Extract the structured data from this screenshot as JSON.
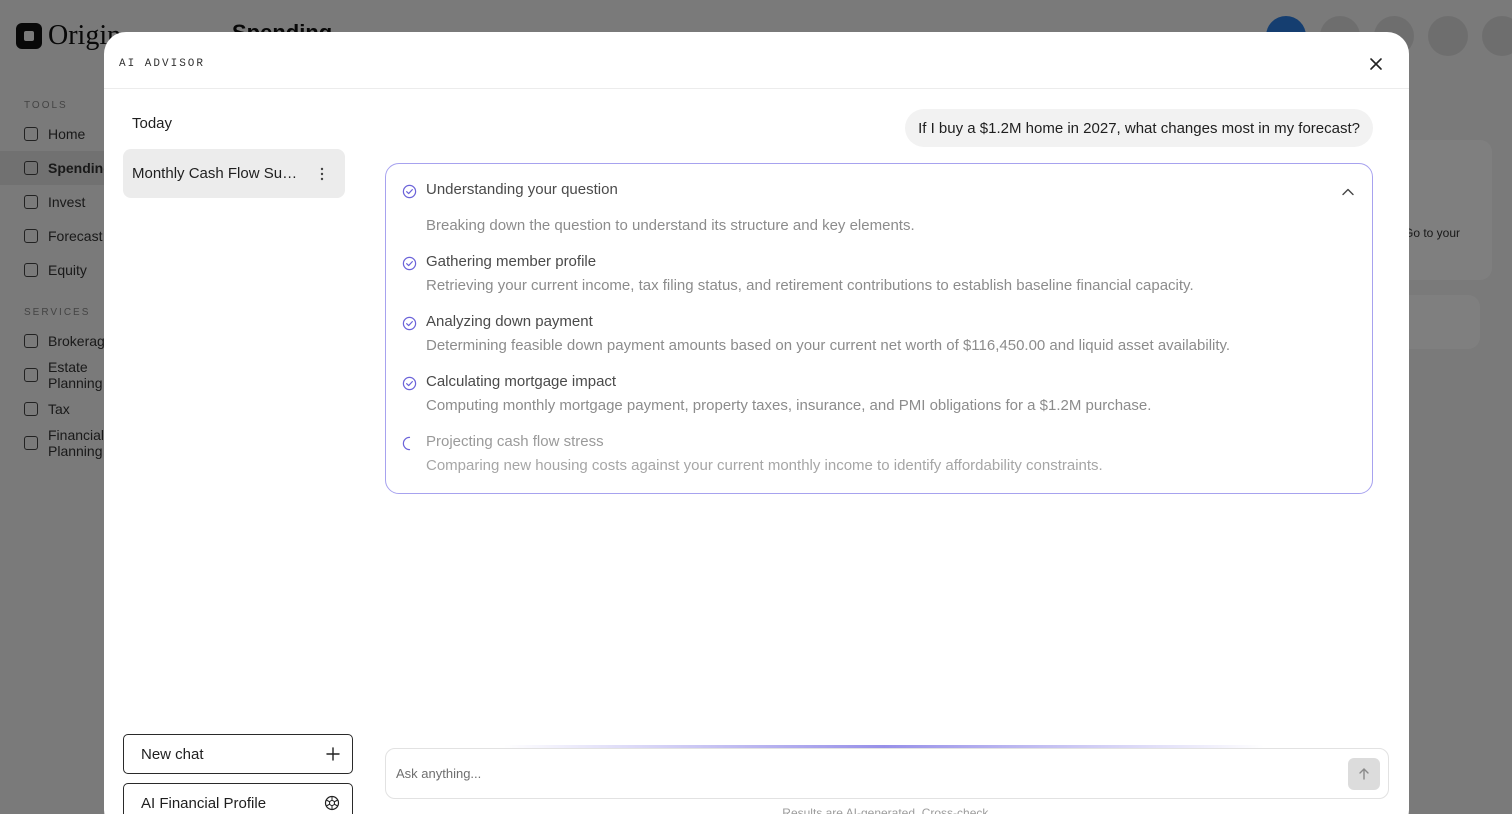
{
  "background": {
    "logo_text": "Origin",
    "page_title": "Spending",
    "nav_section_1": "TOOLS",
    "nav_section_2": "SERVICES",
    "nav_items": [
      {
        "label": "Home",
        "active": false
      },
      {
        "label": "Spending",
        "active": true
      },
      {
        "label": "Invest",
        "active": false
      },
      {
        "label": "Forecast",
        "active": false
      },
      {
        "label": "Equity",
        "active": false
      }
    ],
    "service_items": [
      {
        "label": "Brokerage"
      },
      {
        "label": "Estate Planning"
      },
      {
        "label": "Tax"
      },
      {
        "label": "Financial Planning"
      }
    ],
    "card_text": "Go to your"
  },
  "modal": {
    "title": "AI ADVISOR",
    "close_icon": "close-icon"
  },
  "sidebar": {
    "section_label": "Today",
    "chats": [
      {
        "label": "Monthly Cash Flow Summary",
        "selected": true
      }
    ],
    "new_chat_label": "New chat",
    "new_chat_icon": "plus-icon",
    "profile_label": "AI Financial Profile",
    "profile_icon": "ai-profile-icon"
  },
  "conversation": {
    "user_message": "If I buy a $1.2M home in 2027, what changes most in my forecast?",
    "steps": [
      {
        "status": "done",
        "title": "Understanding your question",
        "description": "Breaking down the question to understand its structure and key elements."
      },
      {
        "status": "done",
        "title": "Gathering member profile",
        "description": "Retrieving your current income, tax filing status, and retirement contributions to establish baseline financial capacity."
      },
      {
        "status": "done",
        "title": "Analyzing down payment",
        "description": "Determining feasible down payment amounts based on your current net worth of $116,450.00 and liquid asset availability."
      },
      {
        "status": "done",
        "title": "Calculating mortgage impact",
        "description": "Computing monthly mortgage payment, property taxes, insurance, and PMI obligations for a $1.2M purchase."
      },
      {
        "status": "in-progress",
        "title": "Projecting cash flow stress",
        "description": "Comparing new housing costs against your current monthly income to identify affordability constraints."
      }
    ]
  },
  "composer": {
    "placeholder": "Ask anything...",
    "value": "",
    "disclaimer": "Results are AI-generated. Cross-check."
  },
  "colors": {
    "accent": "#6b63d9",
    "card_border": "#a7a2ef",
    "overlay": "rgba(0,0,0,0.5)"
  }
}
